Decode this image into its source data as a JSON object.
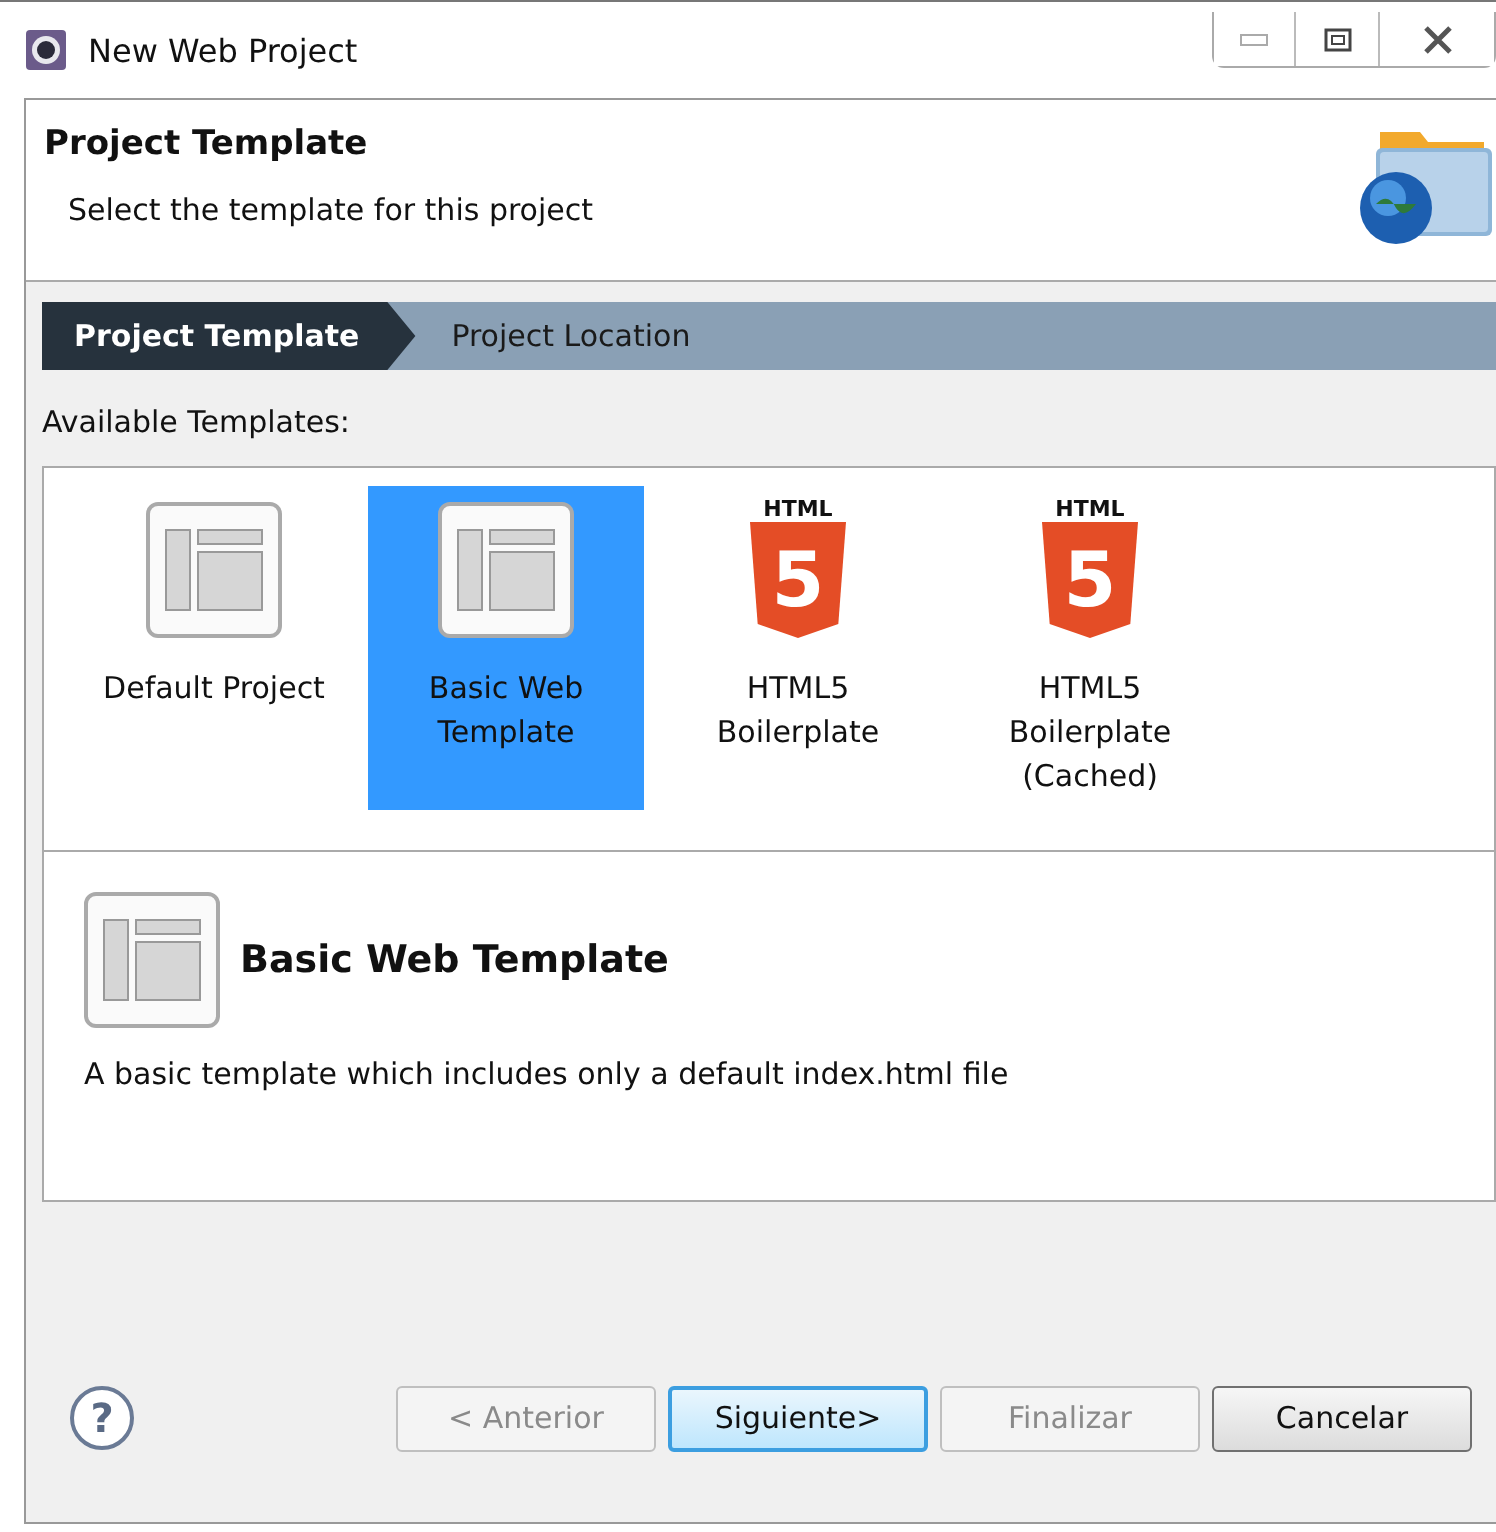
{
  "window": {
    "title": "New Web Project"
  },
  "header": {
    "title": "Project Template",
    "subtitle": "Select the template for this project"
  },
  "steps": [
    {
      "label": "Project Template",
      "selected": true
    },
    {
      "label": "Project Location",
      "selected": false
    }
  ],
  "templates_label": "Available Templates:",
  "templates": [
    {
      "kind": "layout",
      "label": "Default Project",
      "selected": false
    },
    {
      "kind": "layout",
      "label": "Basic Web Template",
      "selected": true
    },
    {
      "kind": "html5",
      "logo_text": "HTML",
      "logo_mark": "5",
      "label": "HTML5 Boilerplate",
      "selected": false
    },
    {
      "kind": "html5",
      "logo_text": "HTML",
      "logo_mark": "5",
      "label": "HTML5 Boilerplate (Cached)",
      "selected": false
    }
  ],
  "description": {
    "title": "Basic Web Template",
    "text": "A basic template which includes only a default index.html file"
  },
  "help_icon": "?",
  "buttons": [
    {
      "label": "< Anterior",
      "disabled": true,
      "default": false
    },
    {
      "label": "Siguiente>",
      "disabled": false,
      "default": true
    },
    {
      "label": "Finalizar",
      "disabled": true,
      "default": false
    },
    {
      "label": "Cancelar",
      "disabled": false,
      "default": false
    }
  ]
}
